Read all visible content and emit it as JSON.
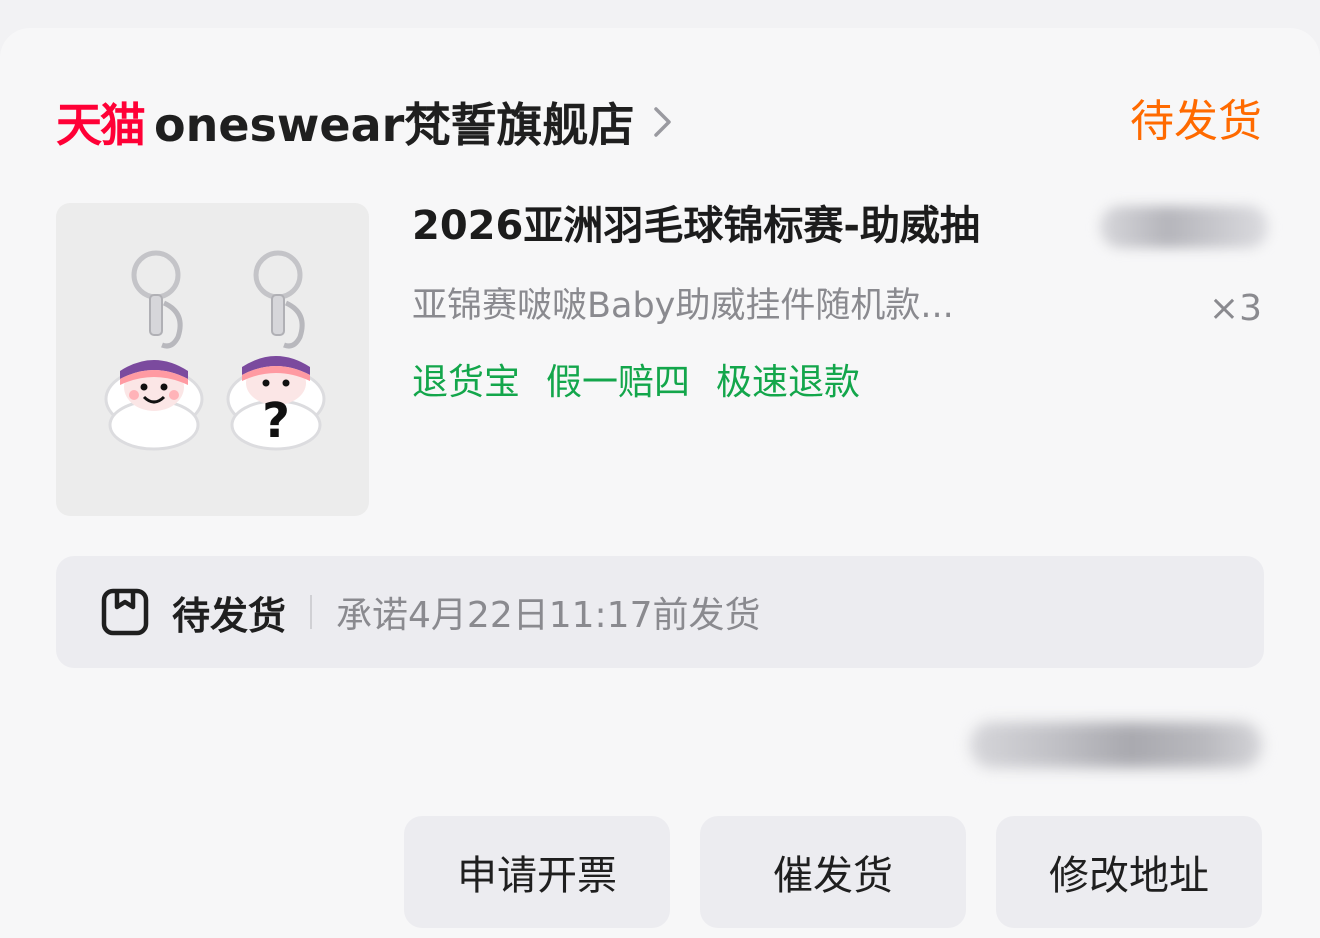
{
  "shop": {
    "platform_logo": "天猫",
    "name": "oneswear梵誓旗舰店",
    "status": "待发货"
  },
  "product": {
    "image_icon": "keychain-product-image",
    "title": "2026亚洲羽毛球锦标赛-助威抽",
    "sku": "亚锦赛啵啵Baby助威挂件随机款...",
    "quantity": "×3",
    "service_tags": [
      "退货宝",
      "假一赔四",
      "极速退款"
    ]
  },
  "shipping": {
    "icon": "package-box-icon",
    "status": "待发货",
    "promise": "承诺4月22日11:17前发货"
  },
  "actions": {
    "invoice": "申请开票",
    "urge_shipping": "催发货",
    "change_address": "修改地址"
  },
  "colors": {
    "tmall_red": "#ff0036",
    "status_orange": "#ff6a00",
    "tag_green": "#13a64b"
  }
}
